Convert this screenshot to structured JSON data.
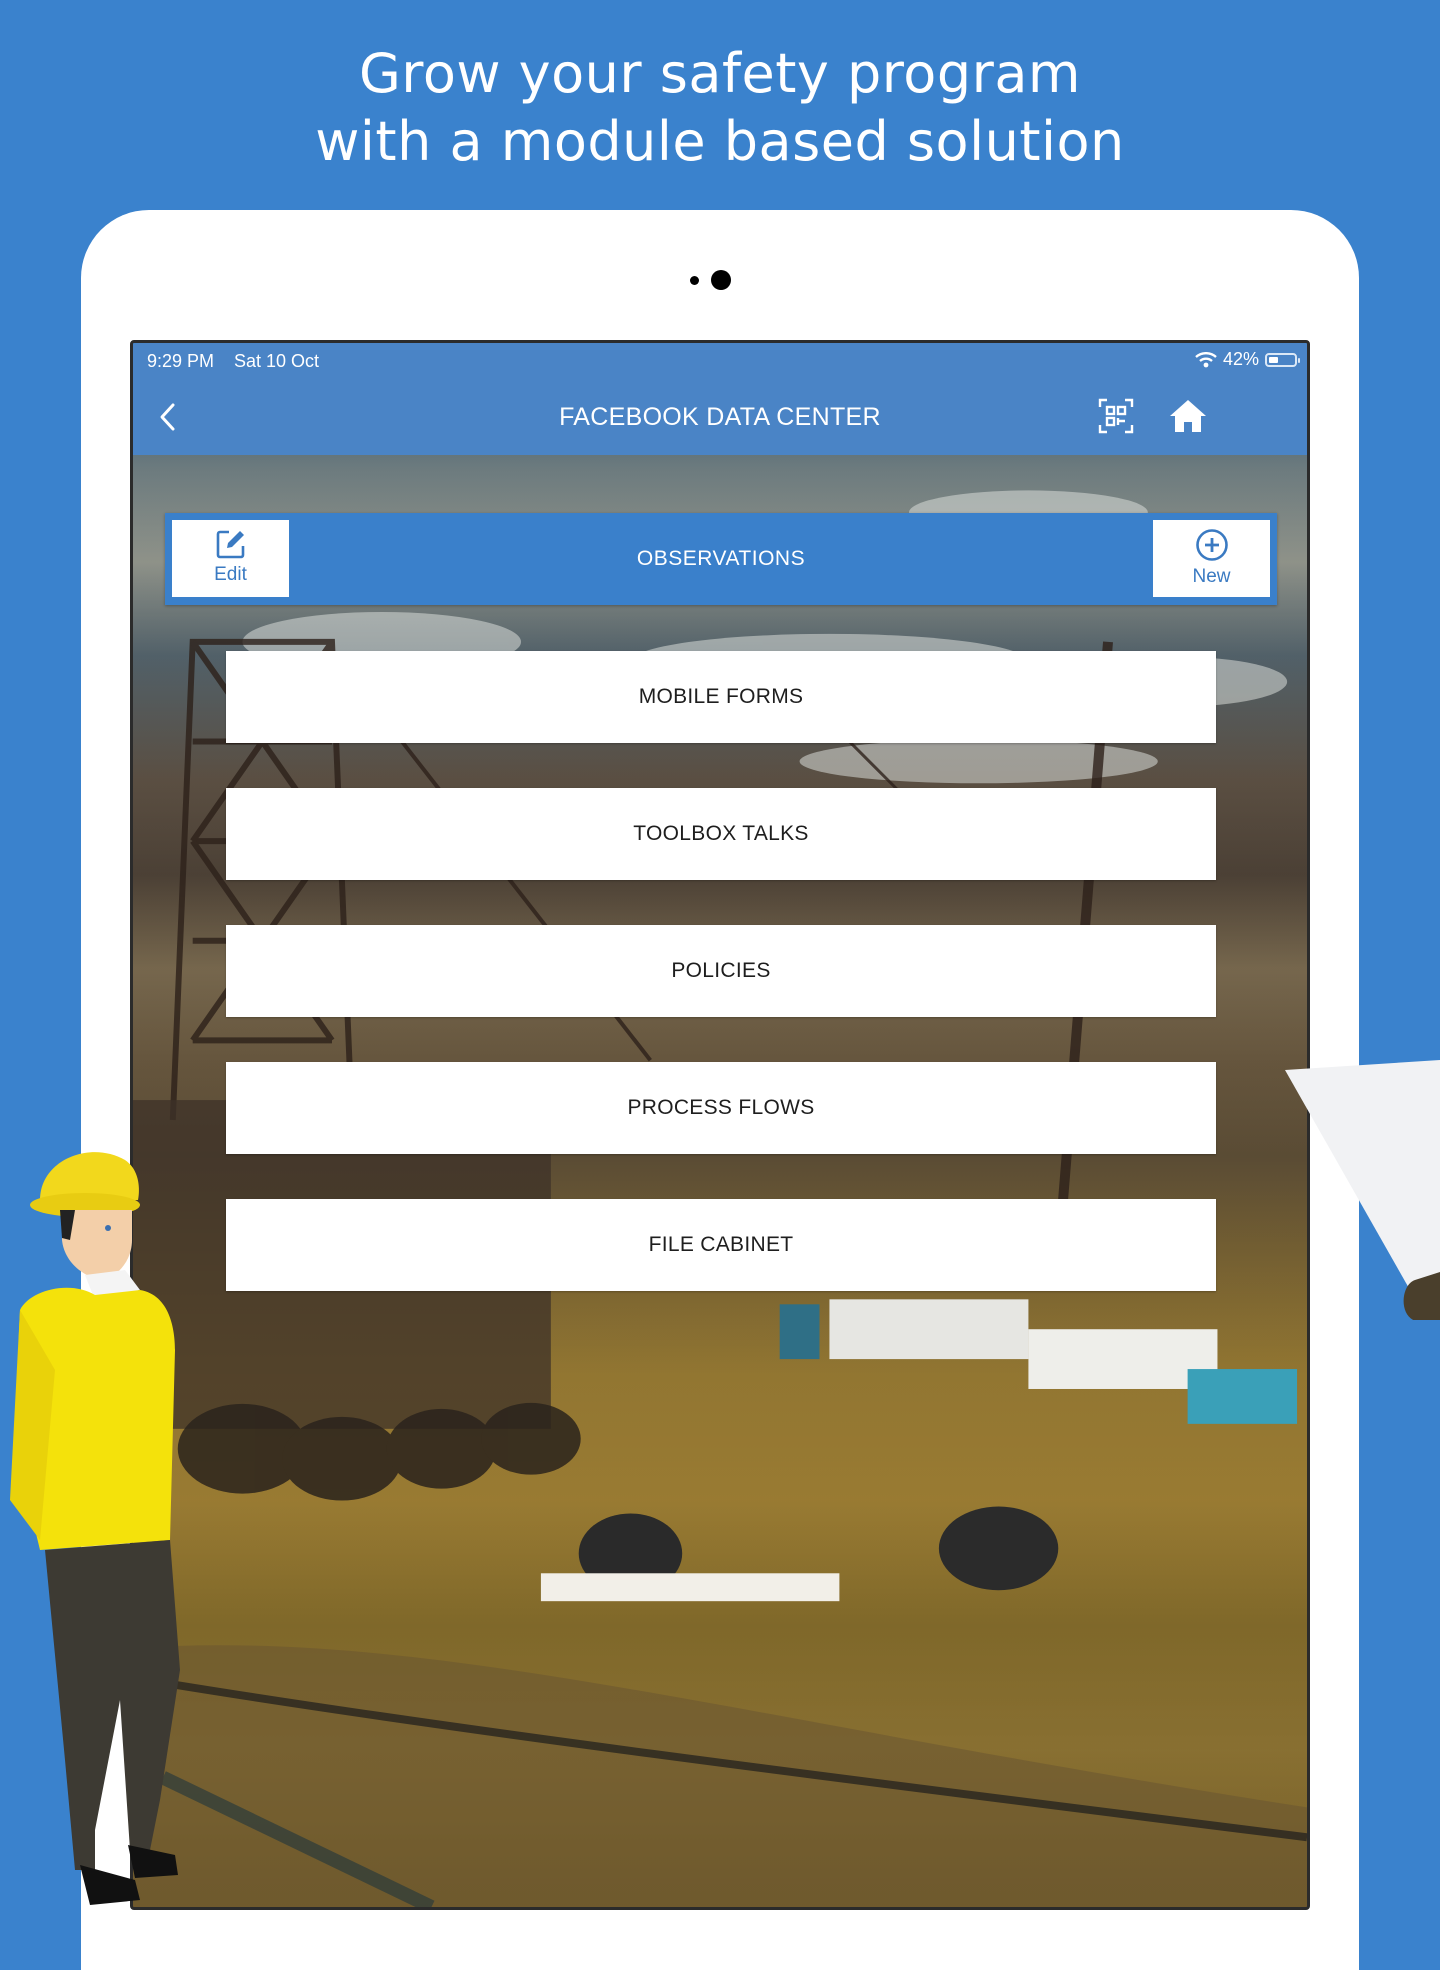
{
  "promo": {
    "headline_line1": "Grow your safety program",
    "headline_line2": "with a module based solution",
    "background_color": "#3a82cd"
  },
  "page_indicator": {
    "total": 2,
    "active_index": 1
  },
  "status_bar": {
    "time": "9:29 PM",
    "date": "Sat 10 Oct",
    "wifi_icon": "wifi-icon",
    "battery_percent_label": "42%",
    "battery_level": 0.42
  },
  "nav_bar": {
    "back_icon": "chevron-left-icon",
    "title": "FACEBOOK DATA CENTER",
    "qr_icon": "qr-scan-icon",
    "home_icon": "home-icon",
    "color": "#4a84c6"
  },
  "observations_bar": {
    "title": "OBSERVATIONS",
    "edit_label": "Edit",
    "edit_icon": "edit-icon",
    "new_label": "New",
    "new_icon": "plus-circle-icon",
    "color": "#3a80cb"
  },
  "menu": [
    {
      "label": "MOBILE FORMS"
    },
    {
      "label": "TOOLBOX TALKS"
    },
    {
      "label": "POLICIES"
    },
    {
      "label": "PROCESS FLOWS"
    },
    {
      "label": "FILE CABINET"
    }
  ]
}
